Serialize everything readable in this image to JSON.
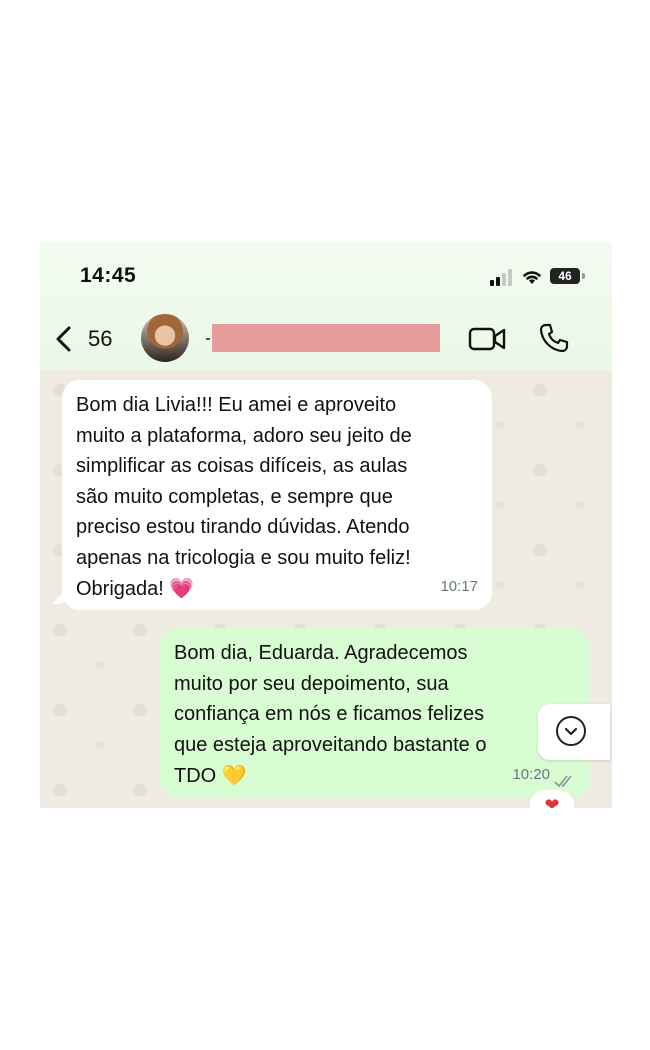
{
  "status_bar": {
    "time": "14:45",
    "battery": "46"
  },
  "header": {
    "back_count": "56",
    "contact_name_redacted": true
  },
  "messages": [
    {
      "direction": "incoming",
      "text": "Bom dia Livia!!! Eu amei e aproveito\nmuito a plataforma, adoro seu jeito de\nsimplificar as coisas difíceis, as aulas\nsão muito completas, e sempre que\npreciso estou tirando dúvidas. Atendo\napenas na tricologia e sou muito feliz!\nObrigada!",
      "emoji": "💗",
      "time": "10:17"
    },
    {
      "direction": "outgoing",
      "text": "Bom dia, Eduarda. Agradecemos\nmuito por seu depoimento, sua\nconfiança em nós e ficamos felizes\nque esteja aproveitando bastante o\nTDO",
      "emoji": "💛",
      "time": "10:20",
      "status": "read"
    }
  ],
  "reaction": "❤",
  "colors": {
    "incoming_bubble": "#ffffff",
    "outgoing_bubble": "#d9fdd3",
    "header_bg": "#eaf8e6",
    "chat_bg": "#efeae2",
    "redaction": "#e89b9b"
  },
  "icons": [
    "back-chevron-icon",
    "avatar",
    "video-call-icon",
    "phone-call-icon",
    "scroll-down-icon",
    "double-check-icon",
    "signal-icon",
    "wifi-icon",
    "battery-icon"
  ]
}
